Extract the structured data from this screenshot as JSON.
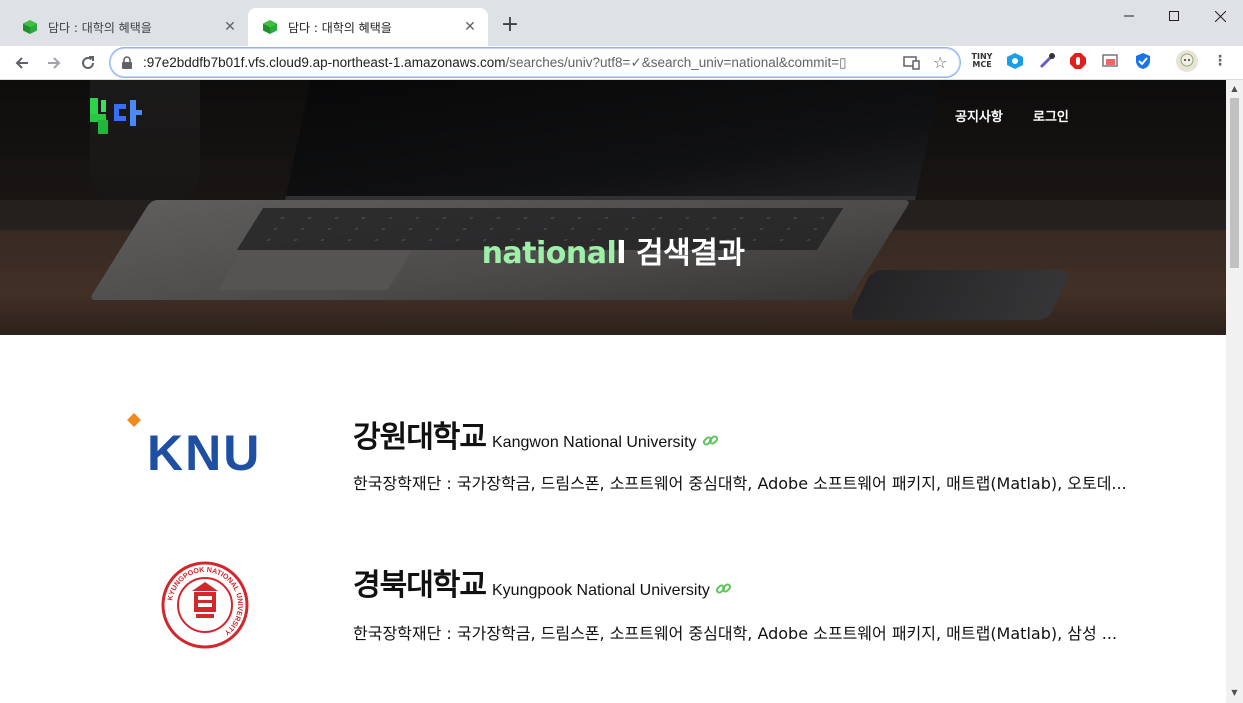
{
  "browser": {
    "tabs": [
      {
        "title": "담다 : 대학의 혜택을",
        "active": false
      },
      {
        "title": "담다 : 대학의 혜택을",
        "active": true
      }
    ],
    "new_tab_label": "+",
    "url_host": ":97e2bddfb7b01f.vfs.cloud9.ap-northeast-1.amazonaws.com",
    "url_path": "/searches/univ?utf8=✓&search_univ=national&commit=▯",
    "extensions": [
      "tinymce-icon",
      "eye-extension-icon",
      "eyedropper-icon",
      "adblock-icon",
      "screenshot-icon",
      "shield-icon",
      "profile-avatar"
    ]
  },
  "site": {
    "nav": {
      "notice": "공지사항",
      "login": "로그인"
    },
    "hero": {
      "keyword": "national",
      "suffix": "l 검색결과"
    }
  },
  "results": [
    {
      "korean_name": "강원대학교",
      "english_name": "Kangwon National University",
      "logo_text": "KNU",
      "description": "한국장학재단 : 국가장학금, 드림스폰, 소프트웨어 중심대학, Adobe 소프트웨어 패키지, 매트랩(Matlab), 오토데..."
    },
    {
      "korean_name": "경북대학교",
      "english_name": "Kyungpook National University",
      "logo_text": "KYUNGPOOK NATIONAL UNIVERSITY",
      "description": "한국장학재단 : 국가장학금, 드림스폰, 소프트웨어 중심대학, Adobe 소프트웨어 패키지, 매트랩(Matlab), 삼성 ..."
    }
  ],
  "colors": {
    "accent_green": "#9ef0a8",
    "link_green": "#5cc55a",
    "knu_blue": "#1e4fa3",
    "knu_orange": "#f08a1c",
    "kyungpook_red": "#d3272e"
  }
}
